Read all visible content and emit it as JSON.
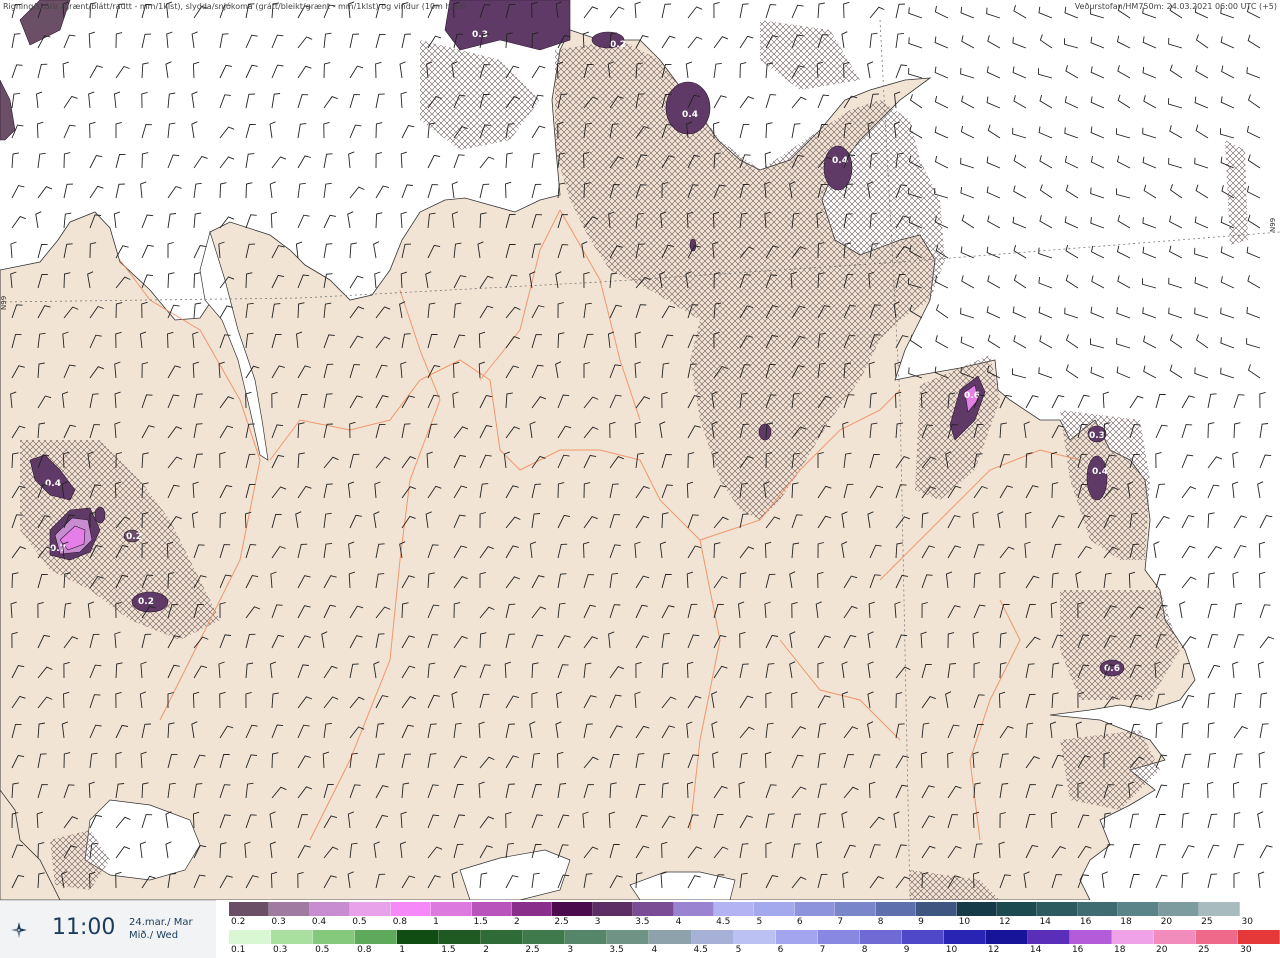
{
  "header": {
    "title_left": "Rigning/skúrir (grænt/blátt/rautt - mm/1klst), slydda/snjókoma (grátt/bleikt/grænt - mm/1klst) og vindur (10m hæð)",
    "title_right": "Veðurstofan/HM750m: 24.03.2021 06:00 UTC (+5)"
  },
  "map": {
    "colors": {
      "sea": "#ffffff",
      "land": "#f2e4d5",
      "river": "#f08a5a",
      "coast": "#333333",
      "hatch": "#6e5a5a",
      "blob_dark": "#5f3a66",
      "blob_mid": "#8c4a9c",
      "blob_light": "#e57ee6"
    },
    "grid_labels": [
      "N99",
      "N99"
    ],
    "precip_labels": [
      "0.3",
      "0.2",
      "0.4",
      "0.4",
      "0.6",
      "0.3",
      "0.4",
      "0.4",
      "0.7",
      "0.2",
      "0.2",
      "0.6"
    ]
  },
  "footer": {
    "time": "11:00",
    "date_line1": "24.mar./ Mar",
    "date_line2": "Mið./ Wed",
    "icon": "compass-icon",
    "snow_scale": {
      "labels": [
        "0.2",
        "0.3",
        "0.4",
        "0.5",
        "0.8",
        "1",
        "1.5",
        "2",
        "2.5",
        "3",
        "3.5",
        "4",
        "4.5",
        "5",
        "6",
        "7",
        "8",
        "9",
        "10",
        "12",
        "14",
        "16",
        "18",
        "20",
        "25",
        "30"
      ],
      "colors": [
        "#6b4f66",
        "#a07aa0",
        "#c88dd0",
        "#e8a2ea",
        "#f589f7",
        "#dc7ae0",
        "#b954bd",
        "#8a2e8c",
        "#4b0c4d",
        "#5d2e66",
        "#7a4c96",
        "#9a84d2",
        "#b3b2f2",
        "#a4a8ec",
        "#8d94dc",
        "#7a86ca",
        "#5e6fae",
        "#3f5680",
        "#153a48",
        "#1d4a4f",
        "#2c5a5e",
        "#3f6c70",
        "#5a8488",
        "#7c9ca0",
        "#a8bcbf",
        "#ffffff"
      ]
    },
    "rain_scale": {
      "labels": [
        "0.1",
        "0.3",
        "0.5",
        "0.8",
        "1",
        "1.5",
        "2",
        "2.5",
        "3",
        "3.5",
        "4",
        "4.5",
        "5",
        "6",
        "7",
        "8",
        "9",
        "10",
        "12",
        "14",
        "16",
        "18",
        "20",
        "25",
        "30"
      ],
      "colors": [
        "#d9f7d2",
        "#a9e0a0",
        "#84c97c",
        "#5ea95b",
        "#0f4d12",
        "#1f5a22",
        "#2f6b36",
        "#3f7a4c",
        "#55866a",
        "#6f9384",
        "#8ea2ac",
        "#a7b1d8",
        "#bcc1f4",
        "#a3a6ee",
        "#8887e2",
        "#6f6ad4",
        "#4f48c8",
        "#2a24b4",
        "#18149a",
        "#5a2eb8",
        "#b35bd8",
        "#f0a2e8",
        "#f28cbc",
        "#ef6a8a",
        "#e53838"
      ]
    }
  }
}
